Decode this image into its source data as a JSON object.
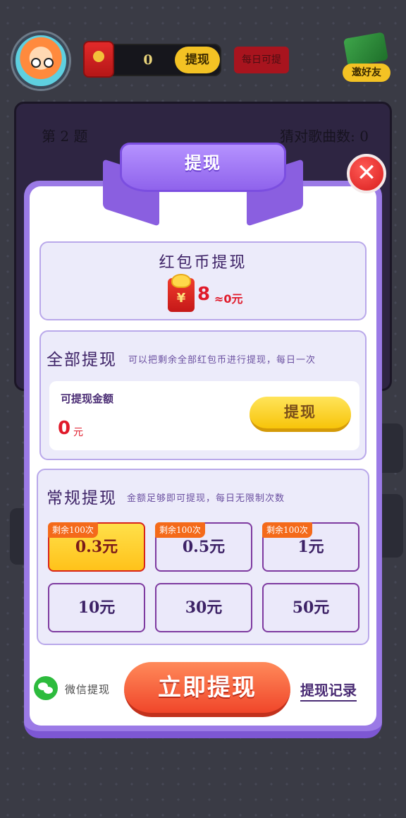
{
  "header": {
    "coin_count": "0",
    "withdraw_label": "提现",
    "daily_label": "每日可提",
    "invite_label": "邀好友"
  },
  "game": {
    "question_label": "第 2 题",
    "score_label": "猜对歌曲数: 0"
  },
  "modal": {
    "title": "提现",
    "close_symbol": "✕",
    "balance": {
      "title": "红包币提现",
      "icon_symbol": "¥",
      "amount": "8",
      "conversion": "≈0元"
    },
    "full_withdraw": {
      "title": "全部提现",
      "description": "可以把剩余全部红包币进行提现，每日一次",
      "amount_label": "可提现金额",
      "amount_value": "0",
      "amount_unit": "元",
      "button_label": "提现"
    },
    "regular": {
      "title": "常规提现",
      "description": "金额足够即可提现，每日无限制次数",
      "options": [
        {
          "label": "0.3元",
          "badge": "剩余100次",
          "selected": true
        },
        {
          "label": "0.5元",
          "badge": "剩余100次",
          "selected": false
        },
        {
          "label": "1元",
          "badge": "剩余100次",
          "selected": false
        },
        {
          "label": "10元",
          "badge": "",
          "selected": false
        },
        {
          "label": "30元",
          "badge": "",
          "selected": false
        },
        {
          "label": "50元",
          "badge": "",
          "selected": false
        }
      ]
    },
    "footer": {
      "method_label": "微信提现",
      "confirm_label": "立即提现",
      "record_label": "提现记录"
    }
  },
  "colors": {
    "accent_purple": "#9b7ae6",
    "money_red": "#e01a2a",
    "selected_yellow": "#ffd23a",
    "button_orange": "#f0462a",
    "wechat_green": "#2dbb3d"
  }
}
